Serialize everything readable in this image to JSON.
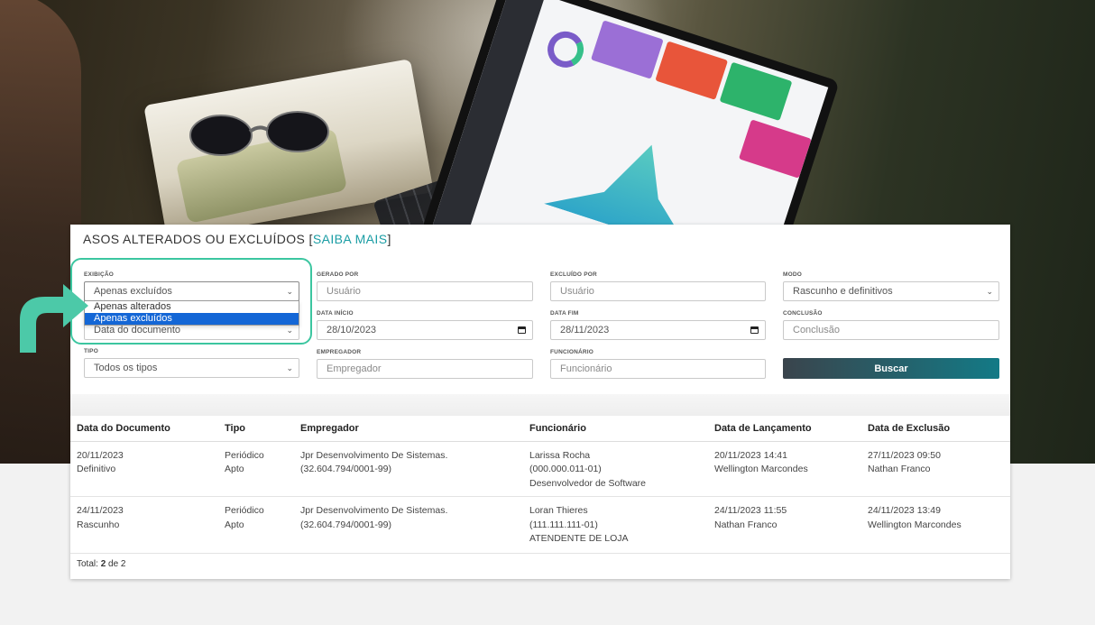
{
  "title": {
    "main": "ASOS ALTERADOS OU EXCLUÍDOS [",
    "link": "SAIBA MAIS",
    "end": "]"
  },
  "filters": {
    "exibicao": {
      "label": "EXIBIÇÃO",
      "value": "Apenas excluídos",
      "options": [
        "Apenas alterados",
        "Apenas excluídos"
      ]
    },
    "data_ref": {
      "value": "Data do documento"
    },
    "tipo": {
      "label": "TIPO",
      "value": "Todos os tipos"
    },
    "gerado_por": {
      "label": "GERADO POR",
      "placeholder": "Usuário"
    },
    "data_inicio": {
      "label": "DATA INÍCIO",
      "value": "28/10/2023"
    },
    "empregador": {
      "label": "EMPREGADOR",
      "placeholder": "Empregador"
    },
    "excluido_por": {
      "label": "EXCLUÍDO POR",
      "placeholder": "Usuário"
    },
    "data_fim": {
      "label": "DATA FIM",
      "value": "28/11/2023"
    },
    "funcionario": {
      "label": "FUNCIONÁRIO",
      "placeholder": "Funcionário"
    },
    "modo": {
      "label": "MODO",
      "value": "Rascunho e definitivos"
    },
    "conclusao": {
      "label": "CONCLUSÃO",
      "placeholder": "Conclusão"
    },
    "buscar": "Buscar"
  },
  "table": {
    "headers": [
      "Data do Documento",
      "Tipo",
      "Empregador",
      "Funcionário",
      "Data de Lançamento",
      "Data de Exclusão"
    ],
    "rows": [
      {
        "doc_date": "20/11/2023",
        "doc_status": "Definitivo",
        "tipo": "Periódico",
        "tipo_status": "Apto",
        "empregador": "Jpr Desenvolvimento De Sistemas.",
        "empregador_cnpj": "(32.604.794/0001-99)",
        "func_nome": "Larissa Rocha",
        "func_cpf": "(000.000.011-01)",
        "func_cargo": "Desenvolvedor de Software",
        "lanc_data": "20/11/2023 14:41",
        "lanc_user": "Wellington Marcondes",
        "excl_data": "27/11/2023 09:50",
        "excl_user": "Nathan Franco"
      },
      {
        "doc_date": "24/11/2023",
        "doc_status": "Rascunho",
        "tipo": "Periódico",
        "tipo_status": "Apto",
        "empregador": "Jpr Desenvolvimento De Sistemas.",
        "empregador_cnpj": "(32.604.794/0001-99)",
        "func_nome": "Loran Thieres",
        "func_cpf": "(111.111.111-01)",
        "func_cargo": "ATENDENTE DE LOJA",
        "lanc_data": "24/11/2023 11:55",
        "lanc_user": "Nathan Franco",
        "excl_data": "24/11/2023 13:49",
        "excl_user": "Wellington Marcondes"
      }
    ],
    "total_prefix": "Total: ",
    "total_count": "2",
    "total_suffix": " de 2"
  },
  "colors": {
    "accent": "#1a9da4",
    "highlight": "#3cc6a0",
    "selected_option": "#1366d6"
  },
  "icons": [
    "chevron-down-icon",
    "calendar-icon",
    "curved-arrow-icon"
  ]
}
